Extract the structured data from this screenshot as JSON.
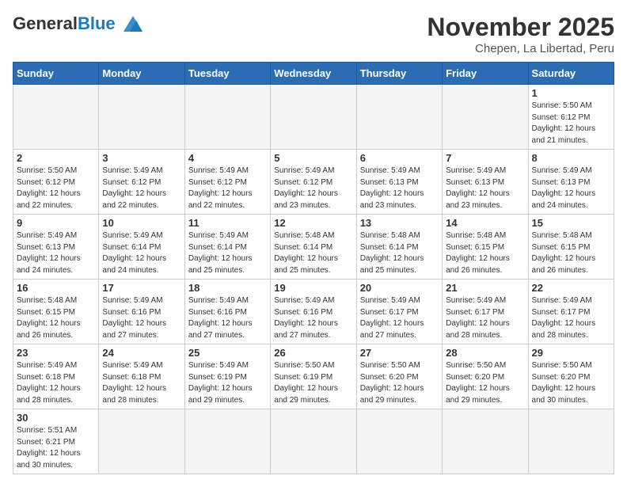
{
  "header": {
    "logo_general": "General",
    "logo_blue": "Blue",
    "month_title": "November 2025",
    "location": "Chepen, La Libertad, Peru"
  },
  "days_of_week": [
    "Sunday",
    "Monday",
    "Tuesday",
    "Wednesday",
    "Thursday",
    "Friday",
    "Saturday"
  ],
  "weeks": [
    [
      {
        "day": "",
        "info": ""
      },
      {
        "day": "",
        "info": ""
      },
      {
        "day": "",
        "info": ""
      },
      {
        "day": "",
        "info": ""
      },
      {
        "day": "",
        "info": ""
      },
      {
        "day": "",
        "info": ""
      },
      {
        "day": "1",
        "info": "Sunrise: 5:50 AM\nSunset: 6:12 PM\nDaylight: 12 hours\nand 21 minutes."
      }
    ],
    [
      {
        "day": "2",
        "info": "Sunrise: 5:50 AM\nSunset: 6:12 PM\nDaylight: 12 hours\nand 22 minutes."
      },
      {
        "day": "3",
        "info": "Sunrise: 5:49 AM\nSunset: 6:12 PM\nDaylight: 12 hours\nand 22 minutes."
      },
      {
        "day": "4",
        "info": "Sunrise: 5:49 AM\nSunset: 6:12 PM\nDaylight: 12 hours\nand 22 minutes."
      },
      {
        "day": "5",
        "info": "Sunrise: 5:49 AM\nSunset: 6:12 PM\nDaylight: 12 hours\nand 23 minutes."
      },
      {
        "day": "6",
        "info": "Sunrise: 5:49 AM\nSunset: 6:13 PM\nDaylight: 12 hours\nand 23 minutes."
      },
      {
        "day": "7",
        "info": "Sunrise: 5:49 AM\nSunset: 6:13 PM\nDaylight: 12 hours\nand 23 minutes."
      },
      {
        "day": "8",
        "info": "Sunrise: 5:49 AM\nSunset: 6:13 PM\nDaylight: 12 hours\nand 24 minutes."
      }
    ],
    [
      {
        "day": "9",
        "info": "Sunrise: 5:49 AM\nSunset: 6:13 PM\nDaylight: 12 hours\nand 24 minutes."
      },
      {
        "day": "10",
        "info": "Sunrise: 5:49 AM\nSunset: 6:14 PM\nDaylight: 12 hours\nand 24 minutes."
      },
      {
        "day": "11",
        "info": "Sunrise: 5:49 AM\nSunset: 6:14 PM\nDaylight: 12 hours\nand 25 minutes."
      },
      {
        "day": "12",
        "info": "Sunrise: 5:48 AM\nSunset: 6:14 PM\nDaylight: 12 hours\nand 25 minutes."
      },
      {
        "day": "13",
        "info": "Sunrise: 5:48 AM\nSunset: 6:14 PM\nDaylight: 12 hours\nand 25 minutes."
      },
      {
        "day": "14",
        "info": "Sunrise: 5:48 AM\nSunset: 6:15 PM\nDaylight: 12 hours\nand 26 minutes."
      },
      {
        "day": "15",
        "info": "Sunrise: 5:48 AM\nSunset: 6:15 PM\nDaylight: 12 hours\nand 26 minutes."
      }
    ],
    [
      {
        "day": "16",
        "info": "Sunrise: 5:48 AM\nSunset: 6:15 PM\nDaylight: 12 hours\nand 26 minutes."
      },
      {
        "day": "17",
        "info": "Sunrise: 5:49 AM\nSunset: 6:16 PM\nDaylight: 12 hours\nand 27 minutes."
      },
      {
        "day": "18",
        "info": "Sunrise: 5:49 AM\nSunset: 6:16 PM\nDaylight: 12 hours\nand 27 minutes."
      },
      {
        "day": "19",
        "info": "Sunrise: 5:49 AM\nSunset: 6:16 PM\nDaylight: 12 hours\nand 27 minutes."
      },
      {
        "day": "20",
        "info": "Sunrise: 5:49 AM\nSunset: 6:17 PM\nDaylight: 12 hours\nand 27 minutes."
      },
      {
        "day": "21",
        "info": "Sunrise: 5:49 AM\nSunset: 6:17 PM\nDaylight: 12 hours\nand 28 minutes."
      },
      {
        "day": "22",
        "info": "Sunrise: 5:49 AM\nSunset: 6:17 PM\nDaylight: 12 hours\nand 28 minutes."
      }
    ],
    [
      {
        "day": "23",
        "info": "Sunrise: 5:49 AM\nSunset: 6:18 PM\nDaylight: 12 hours\nand 28 minutes."
      },
      {
        "day": "24",
        "info": "Sunrise: 5:49 AM\nSunset: 6:18 PM\nDaylight: 12 hours\nand 28 minutes."
      },
      {
        "day": "25",
        "info": "Sunrise: 5:49 AM\nSunset: 6:19 PM\nDaylight: 12 hours\nand 29 minutes."
      },
      {
        "day": "26",
        "info": "Sunrise: 5:50 AM\nSunset: 6:19 PM\nDaylight: 12 hours\nand 29 minutes."
      },
      {
        "day": "27",
        "info": "Sunrise: 5:50 AM\nSunset: 6:20 PM\nDaylight: 12 hours\nand 29 minutes."
      },
      {
        "day": "28",
        "info": "Sunrise: 5:50 AM\nSunset: 6:20 PM\nDaylight: 12 hours\nand 29 minutes."
      },
      {
        "day": "29",
        "info": "Sunrise: 5:50 AM\nSunset: 6:20 PM\nDaylight: 12 hours\nand 30 minutes."
      }
    ],
    [
      {
        "day": "30",
        "info": "Sunrise: 5:51 AM\nSunset: 6:21 PM\nDaylight: 12 hours\nand 30 minutes."
      },
      {
        "day": "",
        "info": ""
      },
      {
        "day": "",
        "info": ""
      },
      {
        "day": "",
        "info": ""
      },
      {
        "day": "",
        "info": ""
      },
      {
        "day": "",
        "info": ""
      },
      {
        "day": "",
        "info": ""
      }
    ]
  ]
}
